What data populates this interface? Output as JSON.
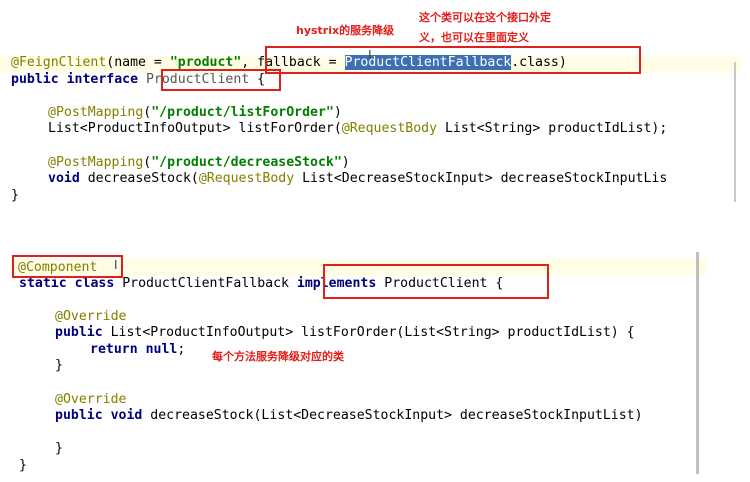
{
  "annotations": {
    "hystrix": "hystrix的服务降级",
    "define_line1": "这个类可以在这个接口外定",
    "define_line2": "义，也可以在里面定义",
    "per_method": "每个方法服务降级对应的类"
  },
  "top_code": {
    "line1": {
      "annotation": "@FeignClient",
      "part1": "(name = ",
      "name_value": "\"product\"",
      "part2": ", fallback = ",
      "fallback_class": "ProductClientFallback",
      "part3": ".class)"
    },
    "line2": {
      "kw": "public interface ",
      "name": "ProductClient",
      "rest": " {"
    },
    "line3": {
      "annotation": "@PostMapping",
      "open": "(",
      "path": "\"/product/listForOrder\"",
      "close": ")"
    },
    "line4": {
      "part1": "List<ProductInfoOutput> listForOrder(",
      "annotation": "@RequestBody",
      "part2": " List<String> productIdList);"
    },
    "line5": {
      "annotation": "@PostMapping",
      "open": "(",
      "path": "\"/product/decreaseStock\"",
      "close": ")"
    },
    "line6": {
      "kw": "void",
      "part1": " decreaseStock(",
      "annotation": "@RequestBody",
      "part2": " List<DecreaseStockInput> decreaseStockInputLis"
    },
    "line7": "}"
  },
  "bottom_code": {
    "line1": {
      "annotation": "@Component"
    },
    "line2": {
      "kw": "static class",
      "mid": " ProductClientFallback ",
      "implements": "implements",
      "iface": " ProductClient",
      "rest": " {"
    },
    "line3": {
      "annotation": "@Override"
    },
    "line4": {
      "kw": "public",
      "rest": " List<ProductInfoOutput> listForOrder(List<String> productIdList) {"
    },
    "line5": {
      "kw": "return null",
      "rest": ";"
    },
    "line6": "}",
    "line7": {
      "annotation": "@Override"
    },
    "line8": {
      "kw": "public void",
      "rest": " decreaseStock(List<DecreaseStockInput> decreaseStockInputList)"
    },
    "line9": "}",
    "line10": "}"
  }
}
